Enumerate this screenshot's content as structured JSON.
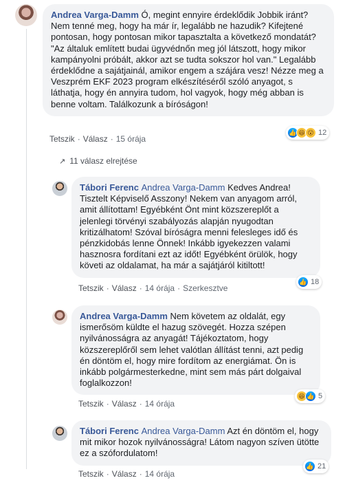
{
  "comments": [
    {
      "author": "Andrea Varga-Damm",
      "text": "Ó, megint ennyire érdeklődik Jobbik iránt? Nem tenné meg, hogy ha már ír, legalább ne hazudik? Kifejtené pontosan, hogy pontosan mikor tapasztalta a következő mondatát? \"Az általuk említett budai ügyvédnőn meg jól látszott, hogy mikor kampányolni próbált, akkor azt se tudta sokszor hol van.\" Legalább érdeklődne a sajátjainál, amikor engem a szájára vesz! Nézze meg a Veszprém EKF 2023 program elkészítéséről szóló anyagot, s láthatja, hogy én annyira tudom, hol vagyok, hogy még abban is benne voltam. Találkozunk a bíróságon!",
      "actions": {
        "like": "Tetszik",
        "reply": "Válasz",
        "time": "15 órája"
      },
      "reactions": {
        "icons": [
          "like-icon",
          "haha-icon",
          "wow-icon"
        ],
        "count": "12"
      }
    }
  ],
  "replies_toggle": {
    "label": "11 válasz elrejtése",
    "icon": "reply-arrow-icon"
  },
  "replies": [
    {
      "author": "Tábori Ferenc",
      "mention": "Andrea Varga-Damm",
      "text": "Kedves Andrea! Tisztelt Képviselő Asszony! Nekem van anyagom arról, amit állítottam! Egyébként Önt mint közszereplőt a jelenlegi törvényi szabályozás alapján nyugodtan kritizálhatom! Szóval bíróságra menni felesleges idő és pénzkidobás lenne Önnek! Inkább igyekezzen valami hasznosra fordítani ezt az időt! Egyébként örülök, hogy követi az oldalamat, ha már a sajátjáról kitiltott!",
      "actions": {
        "like": "Tetszik",
        "reply": "Válasz",
        "time": "14 órája",
        "edited": "Szerkesztve"
      },
      "reactions": {
        "icons": [
          "like-icon"
        ],
        "count": "18"
      }
    },
    {
      "author": "Andrea Varga-Damm",
      "mention": "",
      "text": "Nem követem az oldalát, egy ismerősöm küldte el hazug szövegét. Hozza szépen nyilvánosságra az anyagát! Tájékoztatom, hogy közszereplőről sem lehet valótlan állítást tenni, azt pedig én döntöm el, hogy mire fordítom az energiámat. Ön is inkább polgármesterkedne, mint sem más párt dolgaival foglalkozzon!",
      "actions": {
        "like": "Tetszik",
        "reply": "Válasz",
        "time": "14 órája"
      },
      "reactions": {
        "icons": [
          "haha-icon",
          "like-icon"
        ],
        "count": "5"
      }
    },
    {
      "author": "Tábori Ferenc",
      "mention": "Andrea Varga-Damm",
      "text": "Azt én döntöm el, hogy mit mikor hozok nyilvánosságra! Látom nagyon szíven ütötte ez a szófordulatom!",
      "actions": {
        "like": "Tetszik",
        "reply": "Válasz",
        "time": "14 órája"
      },
      "reactions": {
        "icons": [
          "like-icon"
        ],
        "count": "21"
      }
    }
  ]
}
